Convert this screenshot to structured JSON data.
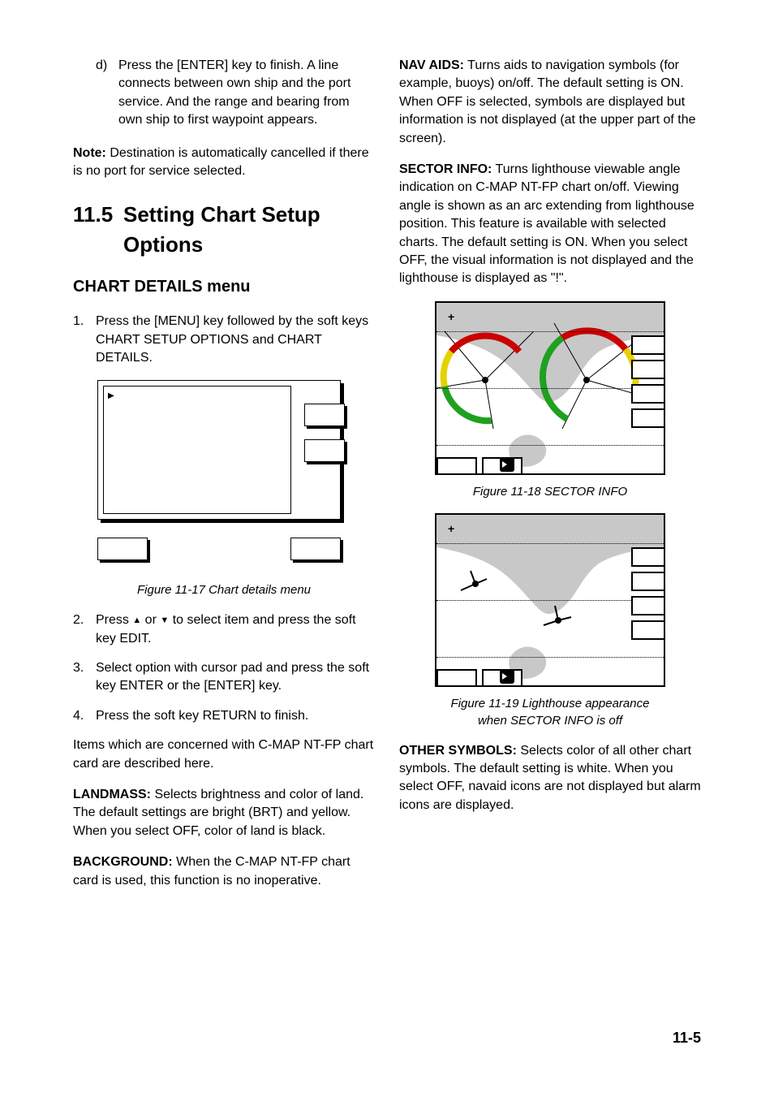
{
  "left": {
    "step_d_marker": "d)",
    "step_d_text": "Press the [ENTER] key to finish. A line connects between own ship and the port service. And the range and bearing from own ship to first waypoint appears.",
    "note_label": "Note:",
    "note_text": " Destination is automatically cancelled if there is no port for service selected.",
    "h1_num": "11.5",
    "h1_text": "Setting Chart Setup Options",
    "h2": "CHART DETAILS menu",
    "steps": {
      "s1_marker": "1.",
      "s1_text": "Press the [MENU] key followed by the soft keys CHART SETUP OPTIONS and CHART DETAILS.",
      "s2_marker": "2.",
      "s2_pre": "Press ",
      "s2_mid": " or ",
      "s2_post": " to select item and press the soft key EDIT.",
      "s3_marker": "3.",
      "s3_text": "Select option with cursor pad and press the soft key ENTER or the [ENTER] key.",
      "s4_marker": "4.",
      "s4_text": "Press the soft key RETURN to finish."
    },
    "fig17_caption": "Figure 11-17 Chart details menu",
    "items_intro": "Items which are concerned with C-MAP NT-FP chart card are described here.",
    "landmass_label": "LANDMASS:",
    "landmass_text": " Selects brightness and color of land. The default settings are bright (BRT) and yellow. When you select OFF, color of land is black.",
    "background_label": "BACKGROUND:",
    "background_text": " When the C-MAP NT-FP chart card is used, this function is no inoperative."
  },
  "right": {
    "nav_label": "NAV AIDS:",
    "nav_text": " Turns aids to navigation symbols (for example, buoys) on/off. The default setting is ON. When OFF is selected, symbols are displayed but information is not displayed (at the upper part of the screen).",
    "sector_label": "SECTOR INFO:",
    "sector_text": " Turns lighthouse viewable angle indication on C-MAP NT-FP chart on/off. Viewing angle is shown as an arc extending from lighthouse position. This feature is available with selected charts. The default setting is ON. When you select OFF, the visual information is not displayed and the lighthouse is displayed as \"!\".",
    "fig18_caption": "Figure 11-18 SECTOR INFO",
    "fig19_caption_l1": "Figure 11-19 Lighthouse appearance",
    "fig19_caption_l2": "when SECTOR INFO is off",
    "other_label": "OTHER SYMBOLS:",
    "other_text": " Selects color of all other chart symbols. The default setting is white. When you select OFF, navaid icons are not displayed but alarm icons are displayed."
  },
  "page_number": "11-5"
}
